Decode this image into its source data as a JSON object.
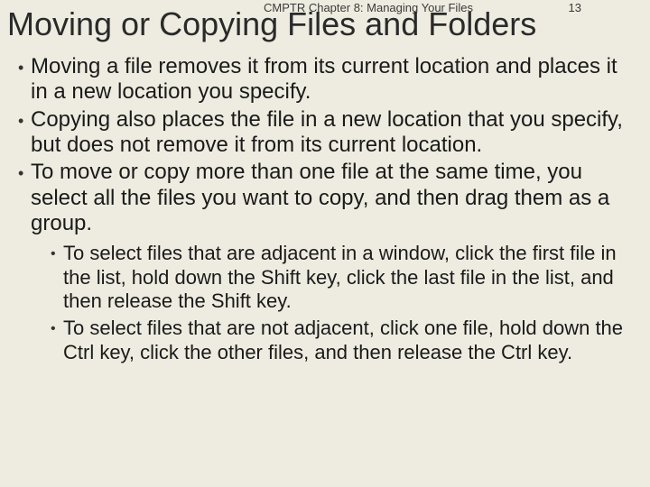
{
  "header": {
    "chapter": "CMPTR Chapter 8: Managing Your Files",
    "page_number": "13",
    "title": "Moving or Copying Files and Folders"
  },
  "bullets": {
    "main": [
      "Moving a file removes it from its current location and places it in a new location you specify.",
      "Copying also places the file in a new location that you specify, but does not remove it from its current location.",
      "To move or copy more than one file at the same time, you select all the files you want to copy, and then drag them as a group."
    ],
    "sub": [
      "To select files that are adjacent in a window, click the first file in the list, hold down the Shift key, click the last file in the list, and then release the Shift key.",
      "To select files that are not adjacent, click one file, hold down the Ctrl key, click the other files, and then release the Ctrl key."
    ]
  }
}
